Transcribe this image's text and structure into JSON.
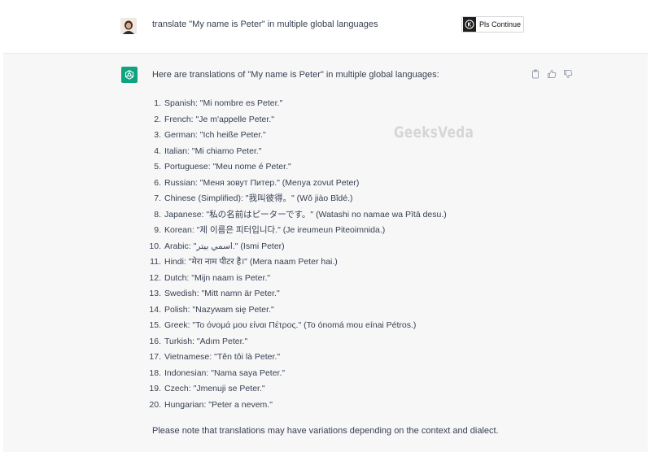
{
  "user_message": {
    "text": "translate \"My name is Peter\" in multiple global languages",
    "continue_button": "Pls Continue"
  },
  "assistant_message": {
    "intro": "Here are translations of \"My name is Peter\" in multiple global languages:",
    "translations": [
      {
        "num": "1.",
        "text": "Spanish: \"Mi nombre es Peter.\""
      },
      {
        "num": "2.",
        "text": "French: \"Je m'appelle Peter.\""
      },
      {
        "num": "3.",
        "text": "German: \"Ich heiße Peter.\""
      },
      {
        "num": "4.",
        "text": "Italian: \"Mi chiamo Peter.\""
      },
      {
        "num": "5.",
        "text": "Portuguese: \"Meu nome é Peter.\""
      },
      {
        "num": "6.",
        "text": "Russian: \"Меня зовут Питер.\" (Menya zovut Peter)"
      },
      {
        "num": "7.",
        "text": "Chinese (Simplified): \"我叫彼得。\" (Wǒ jiào Bǐdé.)"
      },
      {
        "num": "8.",
        "text": "Japanese: \"私の名前はピーターです。\" (Watashi no namae wa Pītā desu.)"
      },
      {
        "num": "9.",
        "text": "Korean: \"제 이름은 피터입니다.\" (Je ireumeun Piteoimnida.)"
      },
      {
        "num": "10.",
        "text": "Arabic: \"اسمي بيتر.\" (Ismi Peter)"
      },
      {
        "num": "11.",
        "text": "Hindi: \"मेरा नाम पीटर है।\" (Mera naam Peter hai.)"
      },
      {
        "num": "12.",
        "text": "Dutch: \"Mijn naam is Peter.\""
      },
      {
        "num": "13.",
        "text": "Swedish: \"Mitt namn är Peter.\""
      },
      {
        "num": "14.",
        "text": "Polish: \"Nazywam się Peter.\""
      },
      {
        "num": "15.",
        "text": "Greek: \"Το όνομά μου είναι Πέτρος.\" (To ónomá mou eínai Pétros.)"
      },
      {
        "num": "16.",
        "text": "Turkish: \"Adım Peter.\""
      },
      {
        "num": "17.",
        "text": "Vietnamese: \"Tên tôi là Peter.\""
      },
      {
        "num": "18.",
        "text": "Indonesian: \"Nama saya Peter.\""
      },
      {
        "num": "19.",
        "text": "Czech: \"Jmenuji se Peter.\""
      },
      {
        "num": "20.",
        "text": "Hungarian: \"Peter a nevem.\""
      }
    ],
    "note": "Please note that translations may have variations depending on the context and dialect."
  },
  "watermark": "GeeksVeda",
  "icons": {
    "copy": "clipboard-icon",
    "like": "thumbs-up-icon",
    "dislike": "thumbs-down-icon",
    "assistant": "openai-logo-icon"
  },
  "colors": {
    "assistant_bg": "#f7f7f8",
    "openai_green": "#10a37f",
    "text": "#374151"
  }
}
